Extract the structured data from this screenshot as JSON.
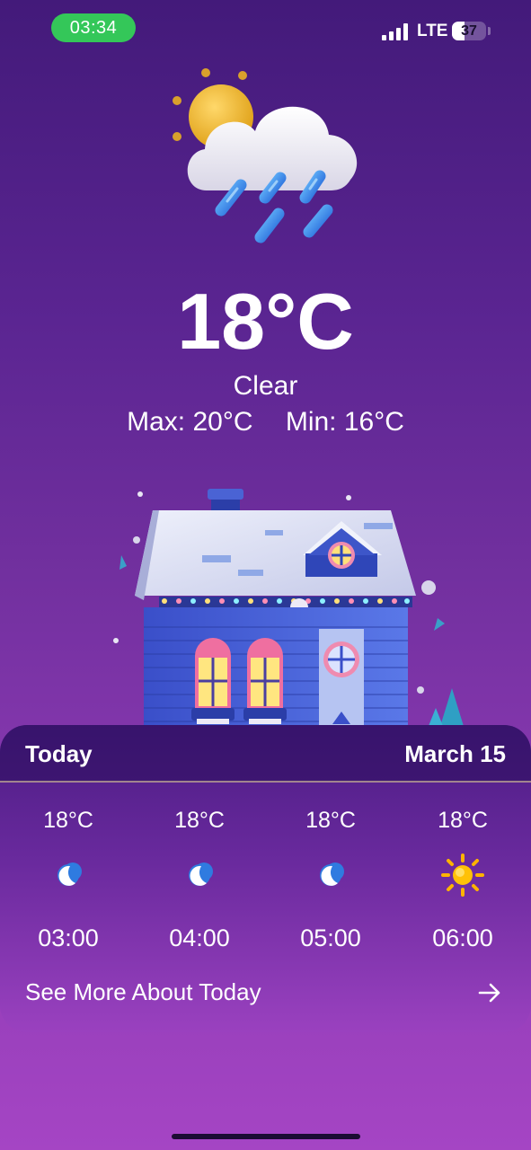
{
  "status_bar": {
    "time": "03:34",
    "network": "LTE",
    "battery": "37",
    "battery_level_percent": 37,
    "signal_bars": 4
  },
  "current": {
    "icon": "sun-cloud-rain-icon",
    "temperature": "18°C",
    "condition": "Clear",
    "max": "Max: 20°C",
    "min": "Min: 16°C"
  },
  "illustration": "house-illustration",
  "today": {
    "label": "Today",
    "date": "March 15",
    "hours": [
      {
        "temp": "18°C",
        "time": "03:00",
        "icon": "moon-icon"
      },
      {
        "temp": "18°C",
        "time": "04:00",
        "icon": "moon-icon"
      },
      {
        "temp": "18°C",
        "time": "05:00",
        "icon": "moon-icon"
      },
      {
        "temp": "18°C",
        "time": "06:00",
        "icon": "sun-icon"
      }
    ],
    "see_more": "See More About Today",
    "see_more_icon": "arrow-right-icon"
  },
  "colors": {
    "background_top": "#431a7a",
    "background_bottom": "#a545c4",
    "time_pill": "#34c759",
    "moon": "#2f7be0",
    "sun": "#ffb300"
  }
}
